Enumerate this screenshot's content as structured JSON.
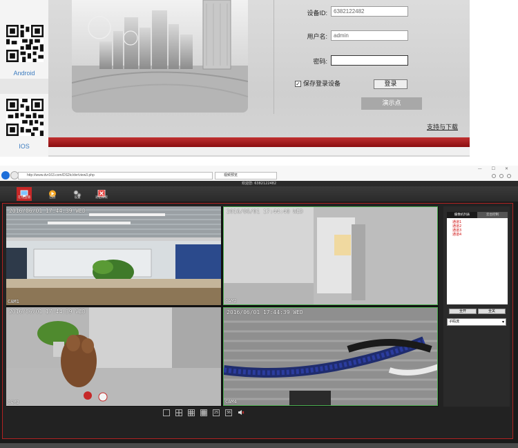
{
  "login": {
    "android_label": "Android",
    "ios_label": "IOS",
    "device_id_label": "设备ID:",
    "device_id_value": "6382122482",
    "username_label": "用户名:",
    "username_value": "admin",
    "password_label": "密码:",
    "password_value": "",
    "save_device_label": "保存登录设备",
    "save_device_checked": "✓",
    "login_button": "登录",
    "demo_button": "演示点",
    "support_link": "支持与下载"
  },
  "browser": {
    "address": "http://www.dvr163.com/DS2tc/dvr/view3.php",
    "tab_title": "视频预览",
    "window_controls": "— ☐ ✕"
  },
  "app": {
    "title": "欢迎您: 6382122482",
    "toolbar": {
      "live_label": "在线直播",
      "playback_label": "回放",
      "settings_label": "设置",
      "exit_label": "退出系统"
    },
    "videos": [
      {
        "osd": "2016/06/01 17:44:39 WED",
        "cam": "CAM1"
      },
      {
        "osd": "2016/06/01 17:44:40 WED",
        "cam": "CAM2"
      },
      {
        "osd": "2016/06/01 17:44:39 WED",
        "cam": "CAM3"
      },
      {
        "osd": "2016/06/01 17:44:39 WED",
        "cam": "CAM4"
      }
    ],
    "layout_buttons": [
      "25",
      "36"
    ],
    "side_panel": {
      "tab_channels": "摄像机列表",
      "tab_ptz": "云台控制",
      "channels": [
        "通道1",
        "通道2",
        "通道3",
        "通道4"
      ],
      "open_all": "全开",
      "close_all": "全关",
      "stream_value": "子码流"
    }
  },
  "colors": {
    "accent_red": "#b22222",
    "channel_red": "#d01010",
    "demo_gray": "#a8a8a8"
  }
}
